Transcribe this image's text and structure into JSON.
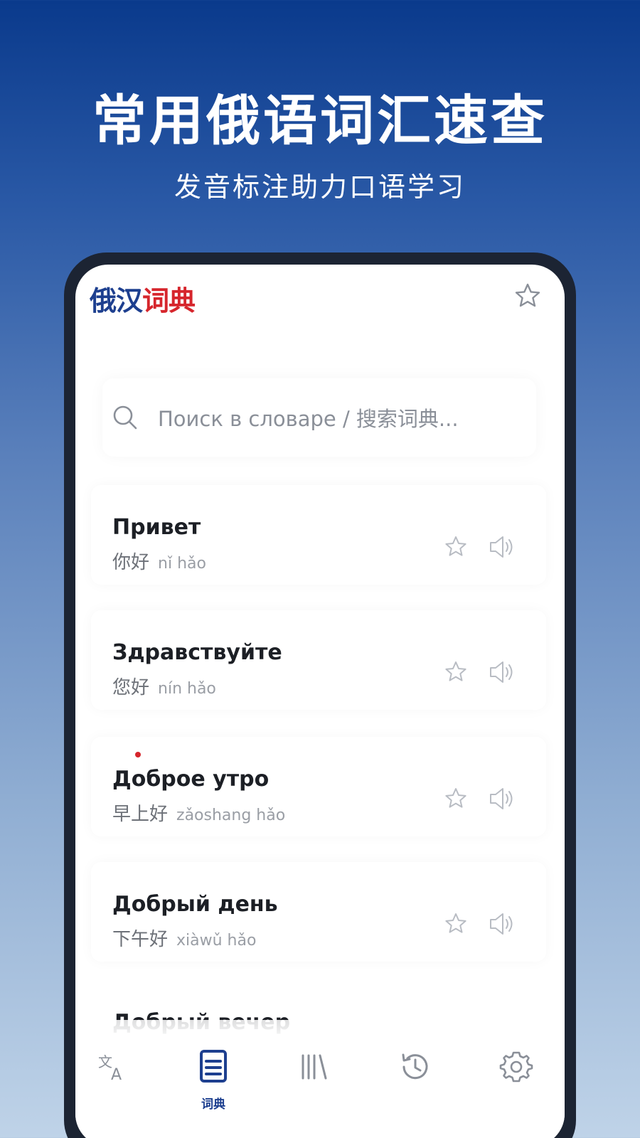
{
  "hero": {
    "title": "常用俄语词汇速查",
    "subtitle": "发音标注助力口语学习"
  },
  "app": {
    "logo_part1": "俄汉",
    "logo_part2": "词典",
    "header_icon": "star-icon"
  },
  "search": {
    "placeholder": "Поиск в словаре / 搜索词典..."
  },
  "words": [
    {
      "ru": "Привет",
      "zh": "你好",
      "pinyin": "nǐ hǎo"
    },
    {
      "ru": "Здравствуйте",
      "zh": "您好",
      "pinyin": "nín hǎo"
    },
    {
      "ru": "Доброе утро",
      "zh": "早上好",
      "pinyin": "zǎoshang hǎo"
    },
    {
      "ru": "Добрый день",
      "zh": "下午好",
      "pinyin": "xiàwǔ hǎo"
    }
  ],
  "partial_word": "Добрый вечер",
  "tabbar": {
    "active_label": "词典",
    "tabs": [
      "translate-icon",
      "dictionary-icon",
      "library-icon",
      "history-icon",
      "settings-icon"
    ]
  },
  "colors": {
    "brand_blue": "#1d3f8f",
    "brand_red": "#d6252c"
  }
}
